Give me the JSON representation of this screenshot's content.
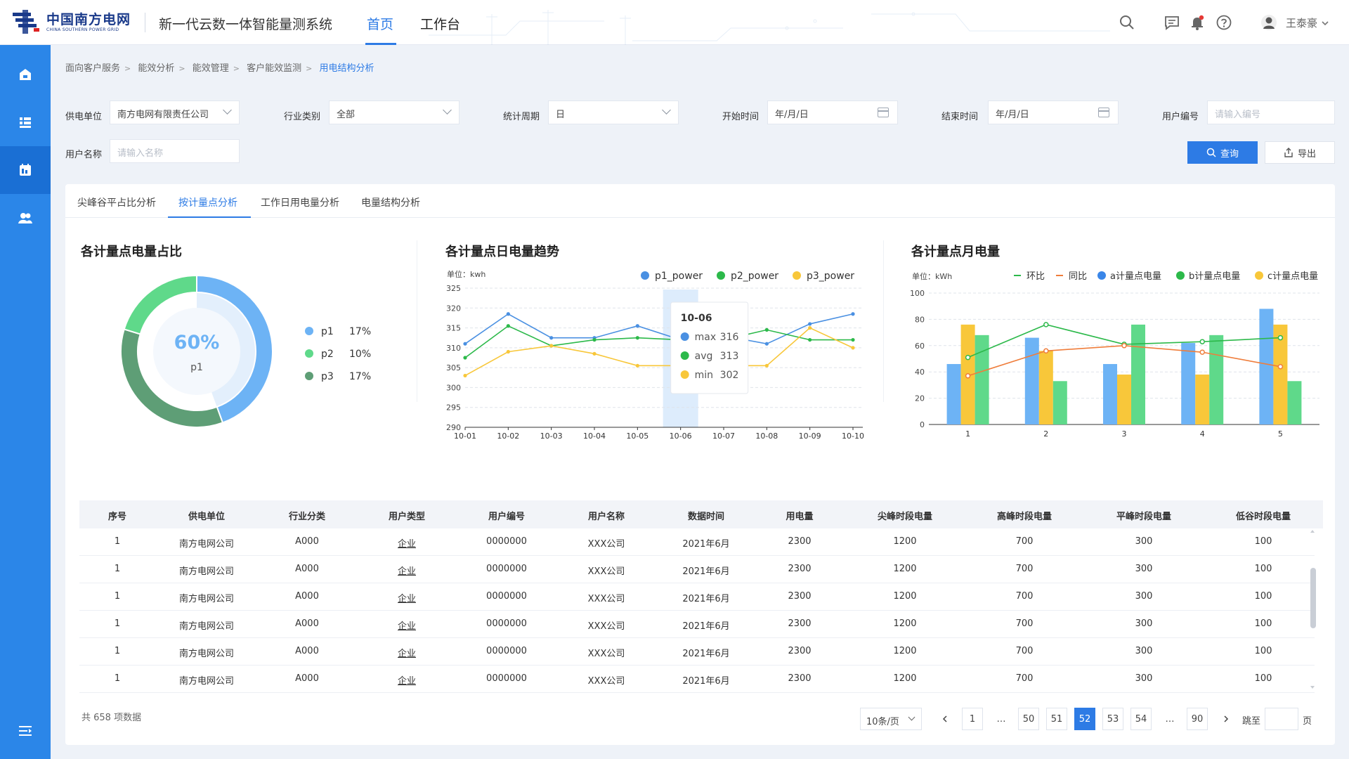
{
  "header": {
    "logo_cn": "中国南方电网",
    "logo_en": "CHINA SOUTHERN POWER GRID",
    "system_title": "新一代云数一体智能量测系统",
    "nav": [
      "首页",
      "工作台"
    ],
    "user": "王泰豪"
  },
  "breadcrumb": [
    "面向客户服务",
    "能效分析",
    "能效管理",
    "客户能效监测",
    "用电结构分析"
  ],
  "filters": {
    "supply_unit": {
      "label": "供电单位",
      "value": "南方电网有限责任公司"
    },
    "industry": {
      "label": "行业类别",
      "value": "全部"
    },
    "period": {
      "label": "统计周期",
      "value": "日"
    },
    "start": {
      "label": "开始时间",
      "value": "年/月/日"
    },
    "end": {
      "label": "结束时间",
      "value": "年/月/日"
    },
    "user_no": {
      "label": "用户编号",
      "placeholder": "请输入编号"
    },
    "user_name": {
      "label": "用户名称",
      "placeholder": "请输入名称"
    },
    "query_btn": "查询",
    "export_btn": "导出"
  },
  "tabs": [
    "尖峰谷平占比分析",
    "按计量点分析",
    "工作日用电量分析",
    "电量结构分析"
  ],
  "active_tab": 1,
  "colors": {
    "accent": "#2d7be5",
    "sidebar": "#2b86e8",
    "blue": "#6db3f5",
    "green": "#5fd98a",
    "yellow": "#f8c73a",
    "darkgreen": "#5e9e76"
  },
  "charts": {
    "donut_title": "各计量点电量占比",
    "line_title": "各计量点日电量趋势",
    "bar_title": "各计量点月电量"
  },
  "chart_data": [
    {
      "type": "pie",
      "title": "各计量点电量占比",
      "center_value": "60%",
      "center_label": "p1",
      "categories": [
        "p1",
        "p2",
        "p3"
      ],
      "values": [
        17,
        10,
        17
      ],
      "value_labels": [
        "17%",
        "10%",
        "17%"
      ]
    },
    {
      "type": "line",
      "title": "各计量点日电量趋势",
      "unit": "单位：kwh",
      "x": [
        "10-01",
        "10-02",
        "10-03",
        "10-04",
        "10-05",
        "10-06",
        "10-07",
        "10-08",
        "10-09",
        "10-10"
      ],
      "ylim": [
        290,
        325
      ],
      "yticks": [
        290,
        295,
        300,
        305,
        310,
        315,
        320,
        325
      ],
      "series": [
        {
          "name": "p1_power",
          "values": [
            311,
            318.5,
            312.5,
            312.5,
            315.5,
            312,
            313,
            311,
            316,
            318.5
          ]
        },
        {
          "name": "p2_power",
          "values": [
            307.5,
            315.5,
            310.5,
            312,
            312.5,
            312,
            312,
            314.5,
            312,
            312
          ]
        },
        {
          "name": "p3_power",
          "values": [
            303,
            309,
            310.5,
            308.5,
            305.5,
            305.5,
            305.5,
            305.5,
            315,
            310
          ]
        }
      ],
      "tooltip": {
        "title": "10-06",
        "rows": [
          {
            "label": "max",
            "value": "316"
          },
          {
            "label": "avg",
            "value": "313"
          },
          {
            "label": "min",
            "value": "302"
          }
        ]
      }
    },
    {
      "type": "bar",
      "title": "各计量点月电量",
      "unit": "单位：kWh",
      "categories": [
        "1",
        "2",
        "3",
        "4",
        "5"
      ],
      "ylim": [
        0,
        100
      ],
      "yticks": [
        0,
        20,
        40,
        60,
        80,
        100
      ],
      "series": [
        {
          "name": "a计量点电量",
          "values": [
            46,
            66,
            46,
            62,
            88
          ]
        },
        {
          "name": "b计量点电量",
          "values": [
            68,
            33,
            76,
            68,
            33
          ]
        },
        {
          "name": "c计量点电量",
          "values": [
            76,
            56,
            38,
            38,
            76
          ]
        }
      ],
      "lines": [
        {
          "name": "环比",
          "values": [
            51,
            76,
            61,
            63,
            66
          ]
        },
        {
          "name": "同比",
          "values": [
            37,
            56,
            60,
            55,
            44
          ]
        }
      ]
    }
  ],
  "table": {
    "columns": [
      "序号",
      "供电单位",
      "行业分类",
      "用户类型",
      "用户编号",
      "用户名称",
      "数据时间",
      "用电量",
      "尖峰时段电量",
      "高峰时段电量",
      "平峰时段电量",
      "低谷时段电量"
    ],
    "rows": [
      [
        "1",
        "南方电网公司",
        "A000",
        "企业",
        "0000000",
        "XXX公司",
        "2021年6月",
        "2300",
        "1200",
        "700",
        "300",
        "100"
      ],
      [
        "1",
        "南方电网公司",
        "A000",
        "企业",
        "0000000",
        "XXX公司",
        "2021年6月",
        "2300",
        "1200",
        "700",
        "300",
        "100"
      ],
      [
        "1",
        "南方电网公司",
        "A000",
        "企业",
        "0000000",
        "XXX公司",
        "2021年6月",
        "2300",
        "1200",
        "700",
        "300",
        "100"
      ],
      [
        "1",
        "南方电网公司",
        "A000",
        "企业",
        "0000000",
        "XXX公司",
        "2021年6月",
        "2300",
        "1200",
        "700",
        "300",
        "100"
      ],
      [
        "1",
        "南方电网公司",
        "A000",
        "企业",
        "0000000",
        "XXX公司",
        "2021年6月",
        "2300",
        "1200",
        "700",
        "300",
        "100"
      ],
      [
        "1",
        "南方电网公司",
        "A000",
        "企业",
        "0000000",
        "XXX公司",
        "2021年6月",
        "2300",
        "1200",
        "700",
        "300",
        "100"
      ]
    ]
  },
  "pagination": {
    "total": "共 658 项数据",
    "page_size": "10条/页",
    "pages": [
      "1",
      "…",
      "50",
      "51",
      "52",
      "53",
      "54",
      "…",
      "90"
    ],
    "current": "52",
    "jump_label": "跳至",
    "page_suffix": "页"
  }
}
